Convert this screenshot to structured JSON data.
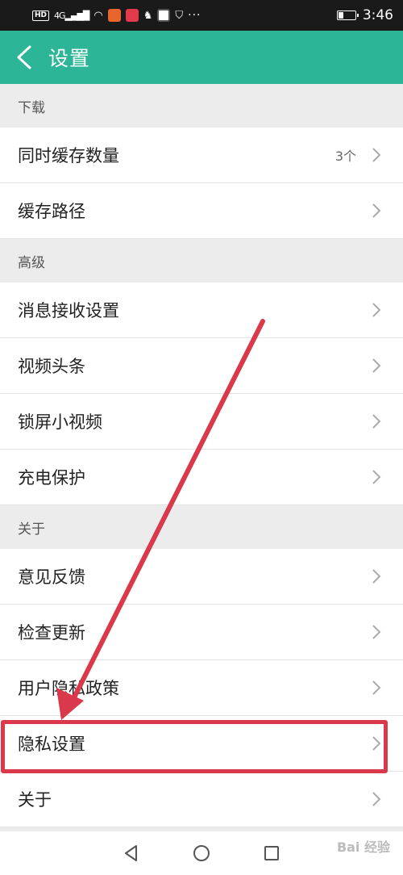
{
  "status_bar": {
    "hd": "HD",
    "network": "4G",
    "dots": "···",
    "time": "3:46"
  },
  "header": {
    "title": "设置"
  },
  "sections": [
    {
      "title": "下载",
      "items": [
        {
          "label": "同时缓存数量",
          "value": "3个"
        },
        {
          "label": "缓存路径",
          "value": ""
        }
      ]
    },
    {
      "title": "高级",
      "items": [
        {
          "label": "消息接收设置",
          "value": ""
        },
        {
          "label": "视频头条",
          "value": ""
        },
        {
          "label": "锁屏小视频",
          "value": ""
        },
        {
          "label": "充电保护",
          "value": ""
        }
      ]
    },
    {
      "title": "关于",
      "items": [
        {
          "label": "意见反馈",
          "value": ""
        },
        {
          "label": "检查更新",
          "value": ""
        },
        {
          "label": "用户隐私政策",
          "value": ""
        },
        {
          "label": "隐私设置",
          "value": ""
        },
        {
          "label": "关于",
          "value": ""
        }
      ]
    }
  ],
  "watermark": "Bai 经验",
  "colors": {
    "header_bg": "#2cb596",
    "annotation": "#d9394a"
  }
}
